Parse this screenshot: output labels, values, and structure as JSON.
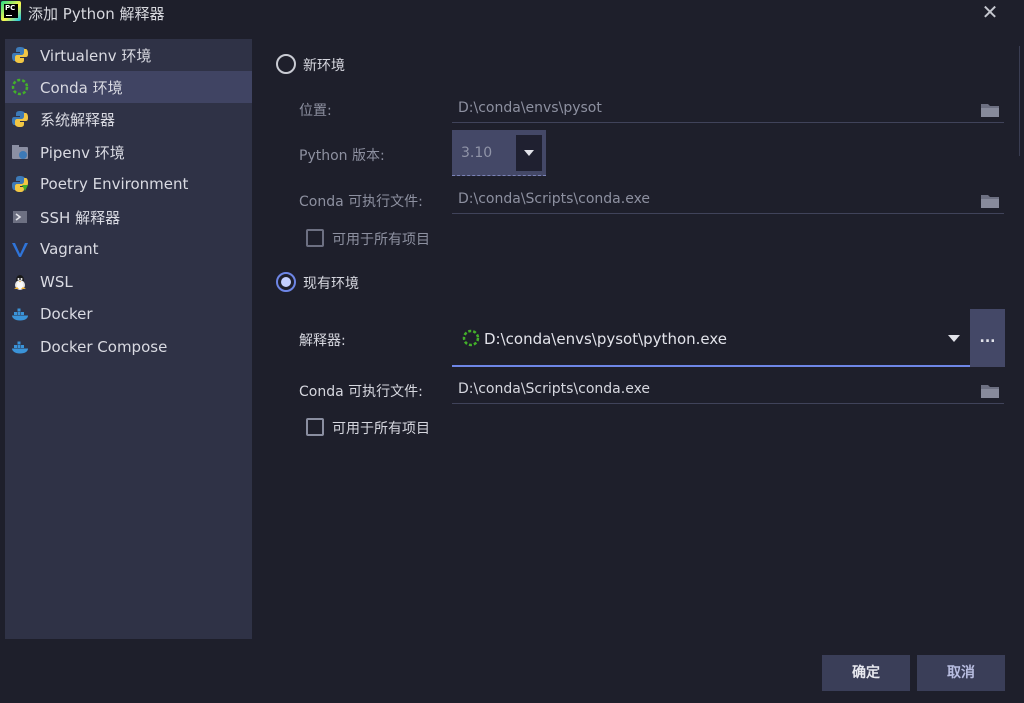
{
  "window": {
    "title": "添加 Python 解释器",
    "app_icon_text": "PC",
    "close_symbol": "✕"
  },
  "sidebar": {
    "items": [
      {
        "label": "Virtualenv 环境",
        "icon": "python-icon"
      },
      {
        "label": "Conda 环境",
        "icon": "conda-icon",
        "selected": true
      },
      {
        "label": "系统解释器",
        "icon": "python-icon"
      },
      {
        "label": "Pipenv 环境",
        "icon": "pipenv-icon"
      },
      {
        "label": "Poetry Environment",
        "icon": "poetry-icon"
      },
      {
        "label": "SSH 解释器",
        "icon": "terminal-icon"
      },
      {
        "label": "Vagrant",
        "icon": "vagrant-icon"
      },
      {
        "label": "WSL",
        "icon": "linux-penguin-icon"
      },
      {
        "label": "Docker",
        "icon": "docker-icon"
      },
      {
        "label": "Docker Compose",
        "icon": "docker-icon"
      }
    ]
  },
  "new_env": {
    "radio_label": "新环境",
    "selected": false,
    "location_label": "位置:",
    "location_value": "D:\\conda\\envs\\pysot",
    "python_version_label": "Python 版本:",
    "python_version_value": "3.10",
    "conda_exe_label": "Conda 可执行文件:",
    "conda_exe_value": "D:\\conda\\Scripts\\conda.exe",
    "all_projects_label": "可用于所有项目",
    "all_projects_checked": false
  },
  "existing_env": {
    "radio_label": "现有环境",
    "selected": true,
    "interpreter_label": "解释器:",
    "interpreter_value": "D:\\conda\\envs\\pysot\\python.exe",
    "browse_label": "...",
    "conda_exe_label": "Conda 可执行文件:",
    "conda_exe_value": "D:\\conda\\Scripts\\conda.exe",
    "all_projects_label": "可用于所有项目",
    "all_projects_checked": false
  },
  "buttons": {
    "ok_label": "确定",
    "cancel_label": "取消"
  },
  "colors": {
    "accent": "#6e86e6",
    "background": "#1e1f2b",
    "sidebar": "#2f3246",
    "selected_item": "#404463"
  }
}
